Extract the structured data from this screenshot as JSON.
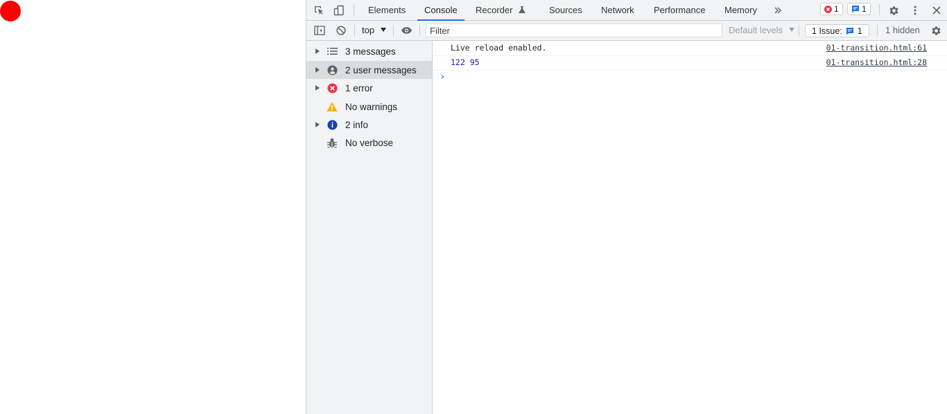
{
  "devtools": {
    "tabs": [
      {
        "label": "Elements"
      },
      {
        "label": "Console"
      },
      {
        "label": "Recorder"
      },
      {
        "label": "Sources"
      },
      {
        "label": "Network"
      },
      {
        "label": "Performance"
      },
      {
        "label": "Memory"
      }
    ],
    "active_tab": "Console",
    "error_badge_count": "1",
    "message_badge_count": "1"
  },
  "toolbar": {
    "context": "top",
    "filter_placeholder": "Filter",
    "levels_label": "Default levels",
    "issues_label": "1 Issue:",
    "issues_count": "1",
    "hidden_label": "1 hidden"
  },
  "sidebar": {
    "items": [
      {
        "label": "3 messages",
        "icon": "list-icon"
      },
      {
        "label": "2 user messages",
        "icon": "user-icon"
      },
      {
        "label": "1 error",
        "icon": "error-icon"
      },
      {
        "label": "No warnings",
        "icon": "warning-icon"
      },
      {
        "label": "2 info",
        "icon": "info-icon"
      },
      {
        "label": "No verbose",
        "icon": "bug-icon"
      }
    ]
  },
  "console": {
    "messages": [
      {
        "text": "Live reload enabled.",
        "source": "01-transition.html:61"
      },
      {
        "text": "122 95",
        "source": "01-transition.html:28"
      }
    ]
  },
  "colors": {
    "ball": "#ff0000",
    "accent": "#1a73e8",
    "error": "#e8344e",
    "number_value": "#1a1aa6"
  }
}
